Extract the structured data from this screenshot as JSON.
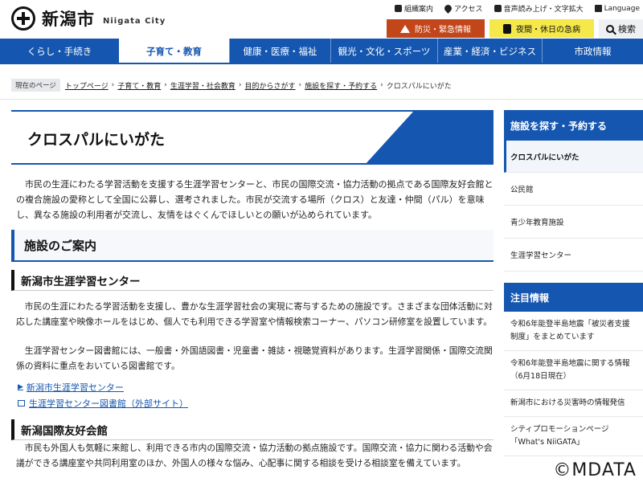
{
  "header": {
    "logo_ja": "新潟市",
    "logo_en": "Niigata City",
    "utility": [
      "組織案内",
      "アクセス",
      "音声読み上げ・文字拡大",
      "Language"
    ],
    "emergency_label": "防災・緊急情報",
    "night_label": "夜間・休日の急病",
    "search_label": "検索"
  },
  "gnav": {
    "items": [
      "くらし・手続き",
      "子育て・教育",
      "健康・医療・福祉",
      "観光・文化・スポーツ",
      "産業・経済・ビジネス",
      "市政情報"
    ]
  },
  "breadcrumb": {
    "tag": "現在のページ",
    "items": [
      "トップページ",
      "子育て・教育",
      "生涯学習・社会教育",
      "目的からさがす",
      "施設を探す・予約する"
    ],
    "current": "クロスパルにいがた"
  },
  "main": {
    "title": "クロスパルにいがた",
    "intro": "　市民の生涯にわたる学習活動を支援する生涯学習センターと、市民の国際交流・協力活動の拠点である国際友好会館との複合施設の愛称として全国に公募し、選考されました。市民が交流する場所（クロス）と友達・仲間（パル）を意味し、異なる施設の利用者が交流し、友情をはぐくんでほしいとの願いが込められています。",
    "h2": "施設のご案内",
    "sec1_title": "新潟市生涯学習センター",
    "sec1_p1": "　市民の生涯にわたる学習活動を支援し、豊かな生涯学習社会の実現に寄与するための施設です。さまざまな団体活動に対応した講座室や映像ホールをはじめ、個人でも利用できる学習室や情報検索コーナー、パソコン研修室を設置しています。",
    "sec1_p2": "　生涯学習センター図書館には、一般書・外国語図書・児童書・雑誌・視聴覚資料があります。生涯学習関係・国際交流関係の資料に重点をおいている図書館です。",
    "link1": "新潟市生涯学習センター",
    "link2": "生涯学習センター図書館（外部サイト）",
    "sec2_title": "新潟国際友好会館",
    "sec2_p1": "　市民も外国人も気軽に来館し、利用できる市内の国際交流・協力活動の拠点施設です。国際交流・協力に関わる活動や会議ができる講座室や共同利用室のほか、外国人の様々な悩み、心配事に関する相談を受ける相談室を備えています。"
  },
  "sidebar": {
    "facility_head": "施設を探す・予約する",
    "facility_items": [
      "クロスパルにいがた",
      "公民館",
      "青少年教育施設",
      "生涯学習センター"
    ],
    "notice_head": "注目情報",
    "notices": [
      "令和6年能登半島地震「被災者支援制度」をまとめています",
      "令和6年能登半島地震に関する情報（6月18日現在）",
      "新潟市における災害時の情報発信",
      "シティプロモーションページ「What's NiiGATA」"
    ]
  },
  "watermark": "©MDATA",
  "colors": {
    "primary": "#1557b0",
    "emergency": "#c3461a",
    "night": "#f5e84a"
  }
}
